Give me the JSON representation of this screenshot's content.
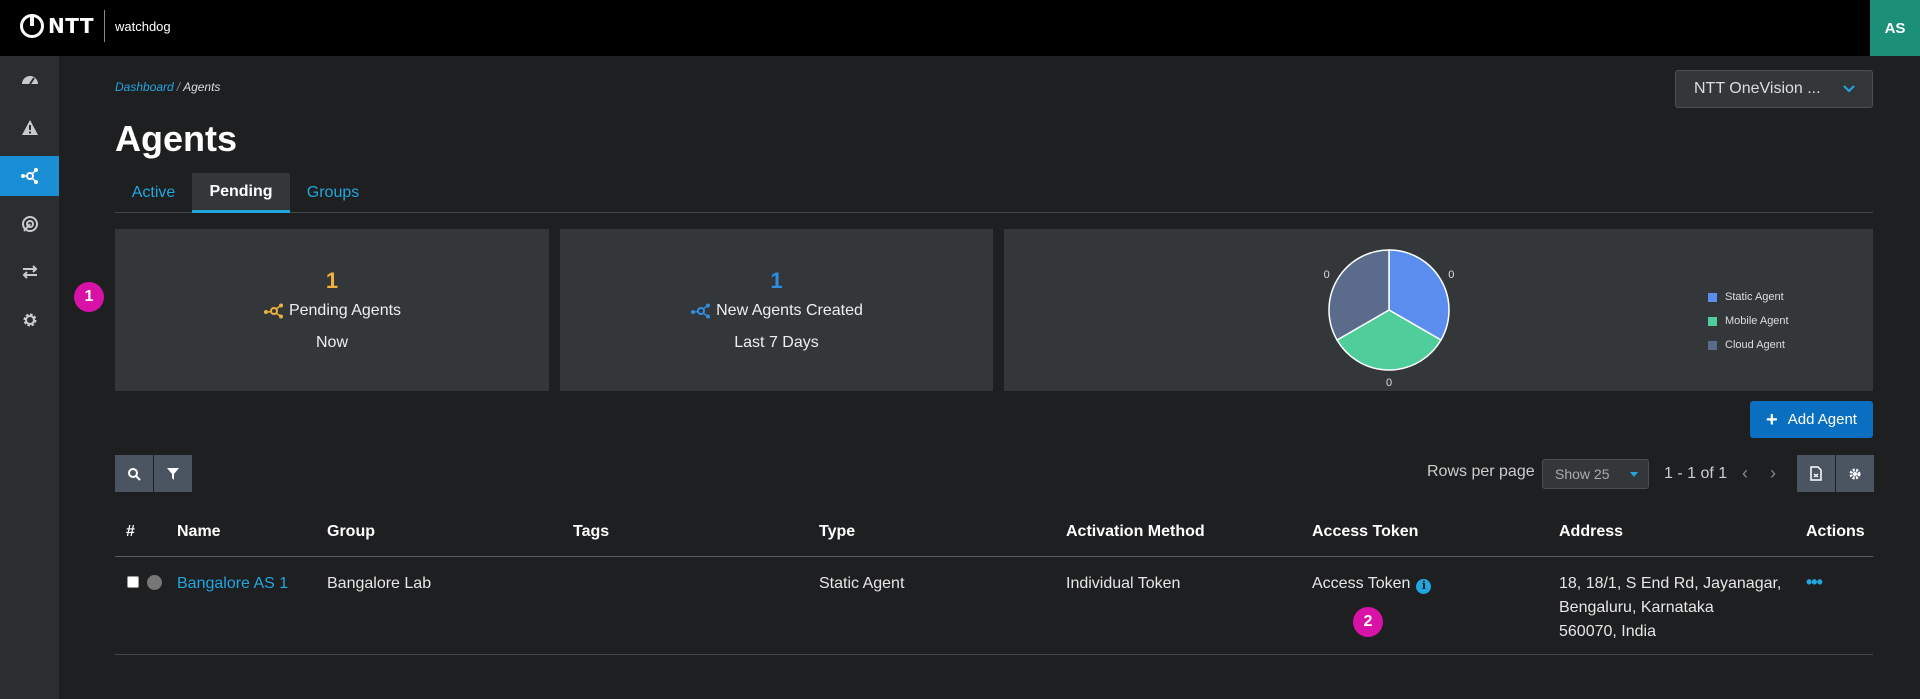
{
  "header": {
    "brand": "NTT",
    "app_name": "watchdog",
    "user_initials": "AS"
  },
  "sidebar": {
    "items": [
      {
        "icon": "dashboard-gauge-icon",
        "active": false
      },
      {
        "icon": "alert-triangle-icon",
        "active": false
      },
      {
        "icon": "agents-network-icon",
        "active": true
      },
      {
        "icon": "radar-icon",
        "active": false
      },
      {
        "icon": "transfer-arrows-icon",
        "active": false
      },
      {
        "icon": "gear-icon",
        "active": false
      }
    ]
  },
  "breadcrumb": {
    "parent": "Dashboard",
    "separator": "/",
    "current": "Agents"
  },
  "page_title": "Agents",
  "org_selector": {
    "value": "NTT OneVision ..."
  },
  "tabs": [
    {
      "label": "Active",
      "active": false
    },
    {
      "label": "Pending",
      "active": true
    },
    {
      "label": "Groups",
      "active": false
    }
  ],
  "cards": {
    "pending": {
      "value": "1",
      "label": "Pending Agents",
      "sub": "Now",
      "color": "#f0b03c"
    },
    "new_created": {
      "value": "1",
      "label": "New Agents Created",
      "sub": "Last 7 Days",
      "color": "#2e8ee0"
    }
  },
  "chart_data": {
    "type": "pie",
    "series": [
      {
        "name": "Static Agent",
        "value": 0,
        "color": "#5b8def"
      },
      {
        "name": "Mobile Agent",
        "value": 0,
        "color": "#4fce9b"
      },
      {
        "name": "Cloud Agent",
        "value": 0,
        "color": "#5a6b8c"
      }
    ],
    "data_labels": [
      "0",
      "0",
      "0"
    ],
    "legend_position": "right"
  },
  "annotations": [
    "1",
    "2"
  ],
  "toolbar": {
    "add_agent_label": "Add Agent",
    "rows_per_page_label": "Rows per page",
    "rows_per_page_value": "Show 25",
    "page_info": "1 - 1 of 1",
    "prev_arrow": "‹",
    "next_arrow": "›"
  },
  "table": {
    "columns": [
      "#",
      "Name",
      "Group",
      "Tags",
      "Type",
      "Activation Method",
      "Access Token",
      "Address",
      "Actions"
    ],
    "rows": [
      {
        "name": "Bangalore AS 1",
        "group": "Bangalore Lab",
        "tags": "",
        "type": "Static Agent",
        "activation_method": "Individual Token",
        "access_token": "Access Token",
        "address_line1": "18, 18/1, S End Rd, Jayanagar,",
        "address_line2": "Bengaluru, Karnataka",
        "address_line3": "560070, India",
        "actions": "•••"
      }
    ]
  },
  "colors": {
    "accent": "#22a6e0",
    "primary_button": "#0a6fc0",
    "annotation": "#d811a7",
    "avatar_bg": "#1b8f77"
  }
}
